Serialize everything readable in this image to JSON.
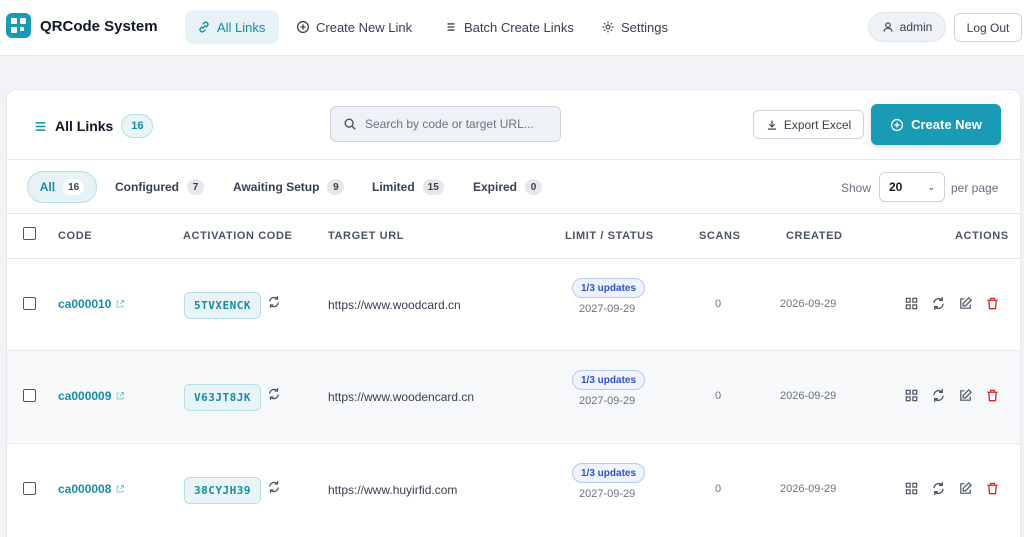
{
  "app": {
    "title": "QRCode System"
  },
  "nav": {
    "all_links": "All Links",
    "create_new_link": "Create New Link",
    "batch_create_links": "Batch Create Links",
    "settings": "Settings"
  },
  "user": {
    "name": "admin",
    "logout_label": "Log Out"
  },
  "colors": {
    "accent": "#1a9bb5",
    "danger": "#dc2626"
  },
  "panel": {
    "title": "All Links",
    "count": "16",
    "search_placeholder": "Search by code or target URL...",
    "export_label": "Export Excel",
    "create_label": "Create New"
  },
  "filters": [
    {
      "label": "All",
      "count": "16"
    },
    {
      "label": "Configured",
      "count": "7"
    },
    {
      "label": "Awaiting Setup",
      "count": "9"
    },
    {
      "label": "Limited",
      "count": "15"
    },
    {
      "label": "Expired",
      "count": "0"
    }
  ],
  "pagination": {
    "show_label": "Show",
    "per_page_value": "20",
    "per_page_label": "per page"
  },
  "table": {
    "headers": {
      "code": "CODE",
      "activation": "ACTIVATION CODE",
      "target": "TARGET URL",
      "limit": "LIMIT / STATUS",
      "scans": "SCANS",
      "created": "CREATED",
      "actions": "ACTIONS"
    },
    "rows": [
      {
        "code": "ca000010",
        "activation": "5TVXENCK",
        "target": "https://www.woodcard.cn",
        "updates": "1/3 updates",
        "limit_date": "2027-09-29",
        "scans": "0",
        "created": "2026-09-29"
      },
      {
        "code": "ca000009",
        "activation": "V63JT8JK",
        "target": "https://www.woodencard.cn",
        "updates": "1/3 updates",
        "limit_date": "2027-09-29",
        "scans": "0",
        "created": "2026-09-29"
      },
      {
        "code": "ca000008",
        "activation": "38CYJH39",
        "target": "https://www.huyirfid.com",
        "updates": "1/3 updates",
        "limit_date": "2027-09-29",
        "scans": "0",
        "created": "2026-09-29"
      }
    ]
  }
}
